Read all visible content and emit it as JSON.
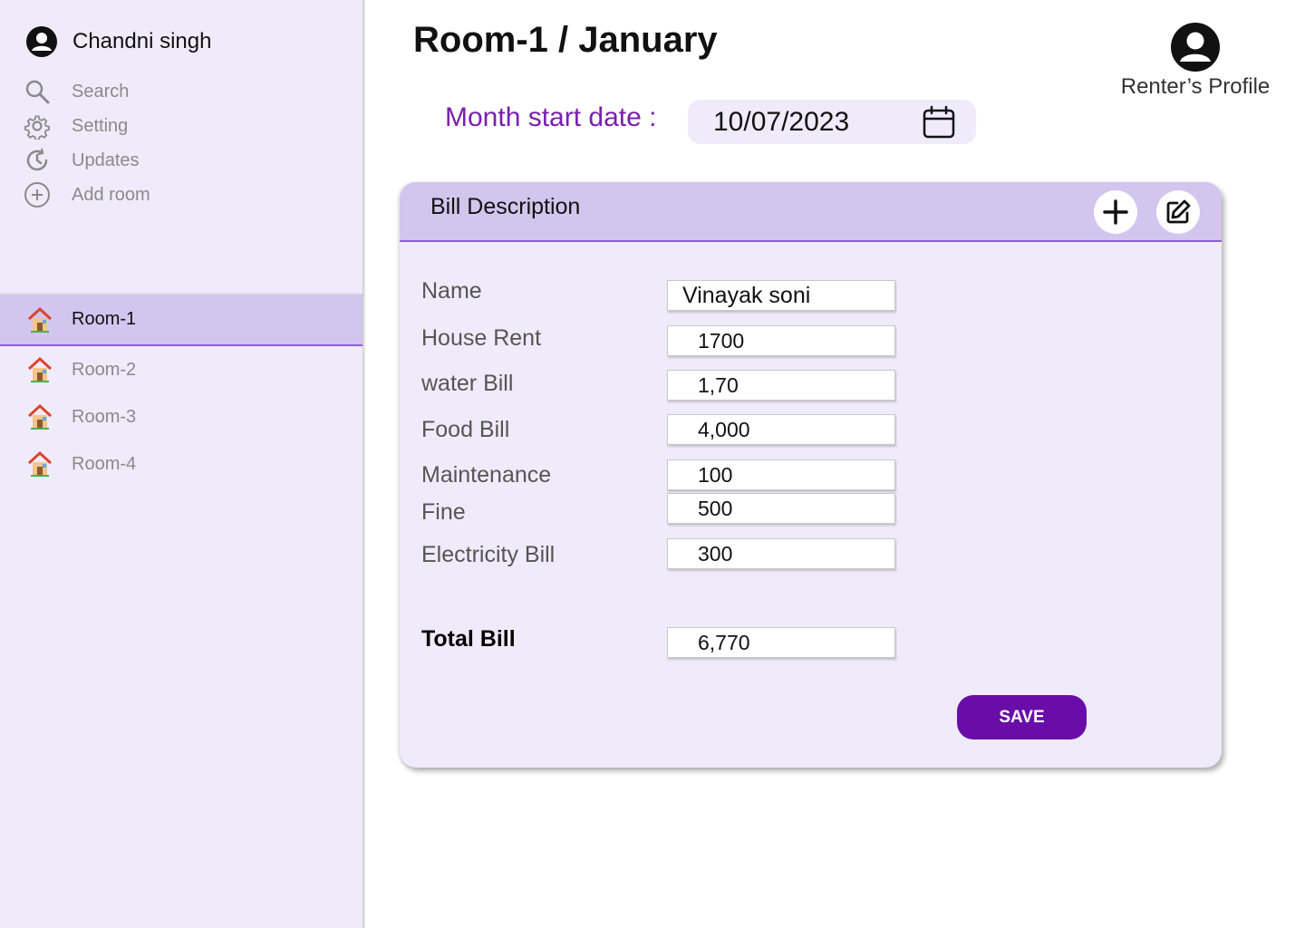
{
  "user": {
    "name": "Chandni singh",
    "icon": "user-avatar-icon"
  },
  "menu": [
    {
      "label": "Search",
      "icon": "search-icon"
    },
    {
      "label": "Setting",
      "icon": "gear-icon"
    },
    {
      "label": "Updates",
      "icon": "history-icon"
    },
    {
      "label": "Add room",
      "icon": "plus-circle-icon"
    }
  ],
  "rooms": [
    {
      "label": "Room-1",
      "icon": "house-icon",
      "active": true
    },
    {
      "label": "Room-2",
      "icon": "house-icon",
      "active": false
    },
    {
      "label": "Room-3",
      "icon": "house-icon",
      "active": false
    },
    {
      "label": "Room-4",
      "icon": "house-icon",
      "active": false
    }
  ],
  "header": {
    "title": "Room-1 / January"
  },
  "profile": {
    "label": "Renter’s Profile",
    "icon": "user-avatar-icon"
  },
  "date": {
    "label": "Month start date :",
    "value": "10/07/2023",
    "icon": "calendar-icon"
  },
  "bill": {
    "title": "Bill Description",
    "add_icon": "plus-icon",
    "edit_icon": "edit-icon",
    "fields": [
      {
        "label": "Name",
        "value": "Vinayak soni"
      },
      {
        "label": "House Rent",
        "value": "1700"
      },
      {
        "label": "water Bill",
        "value": "1,70"
      },
      {
        "label": "Food Bill",
        "value": "4,000"
      },
      {
        "label": "Maintenance",
        "value": "100"
      },
      {
        "label": "Fine",
        "value": "500"
      },
      {
        "label": "Electricity Bill",
        "value": "300"
      }
    ],
    "total": {
      "label": "Total Bill",
      "value": "6,770"
    },
    "save_label": "SAVE"
  },
  "colors": {
    "sidebar_bg": "#efebfa",
    "highlight_bg": "#d2c5ee",
    "accent": "#6a0da8",
    "date_label": "#7a1fb0"
  }
}
